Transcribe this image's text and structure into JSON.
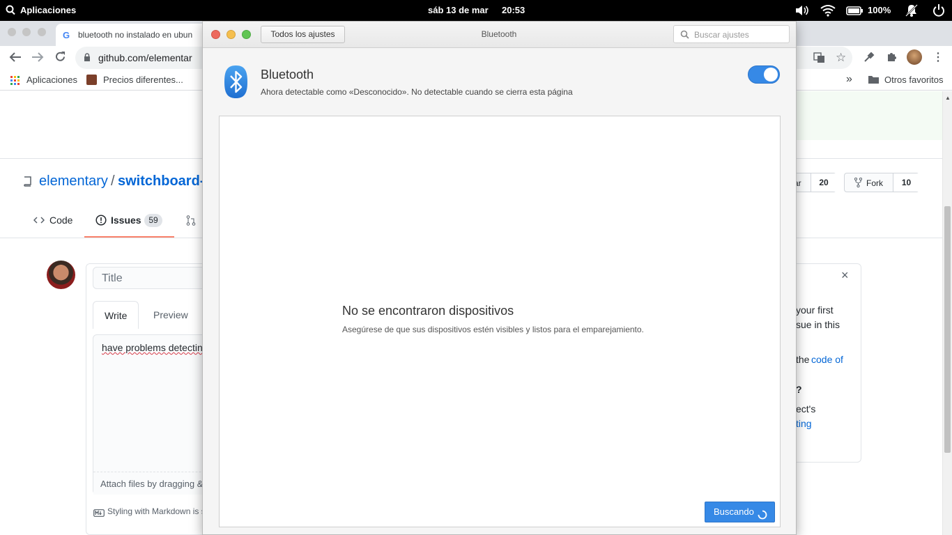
{
  "top_panel": {
    "applications_label": "Aplicaciones",
    "date": "sáb 13 de mar",
    "time": "20:53",
    "battery": "100%"
  },
  "browser": {
    "tab_title": "bluetooth no instalado en ubun",
    "url": "github.com/elementar",
    "bookmarks": [
      {
        "label": "Aplicaciones"
      },
      {
        "label": "Precios diferentes..."
      }
    ],
    "more_chevron": "»",
    "other_bookmarks": "Otros favoritos"
  },
  "github": {
    "owner": "elementary",
    "separator": "/",
    "repo": "switchboard-",
    "star_fragment": "ar",
    "star_count": "20",
    "fork_label": "Fork",
    "fork_count": "10",
    "tabs": {
      "code": "Code",
      "issues": "Issues",
      "issues_count": "59"
    },
    "title_placeholder": "Title",
    "write_tab": "Write",
    "preview_tab": "Preview",
    "body_text": "have problems detectin",
    "attach_text": "Attach files by dragging &",
    "markdown_text": "Styling with Markdown is s",
    "sidebar_close": "×",
    "sidebar_lines": [
      {
        "text": "your first"
      },
      {
        "text": "sue in this"
      },
      {
        "text": "the ",
        "link": "code of"
      },
      {
        "text": "?"
      },
      {
        "text": "ect's"
      },
      {
        "link": "ting"
      }
    ]
  },
  "dialog": {
    "back_button": "Todos los ajustes",
    "title": "Bluetooth",
    "search_placeholder": "Buscar ajustes",
    "bluetooth_name": "Bluetooth",
    "bluetooth_desc": "Ahora detectable como «Desconocido». No detectable cuando se cierra esta página",
    "toggle_on": true,
    "empty_title": "No se encontraron dispositivos",
    "empty_subtitle": "Asegúrese de que sus dispositivos estén visibles y listos para el emparejamiento.",
    "scan_button": "Buscando"
  },
  "colors": {
    "accent": "#3689e6",
    "gh_link": "#0366d6",
    "issues_underline": "#f9826c"
  }
}
